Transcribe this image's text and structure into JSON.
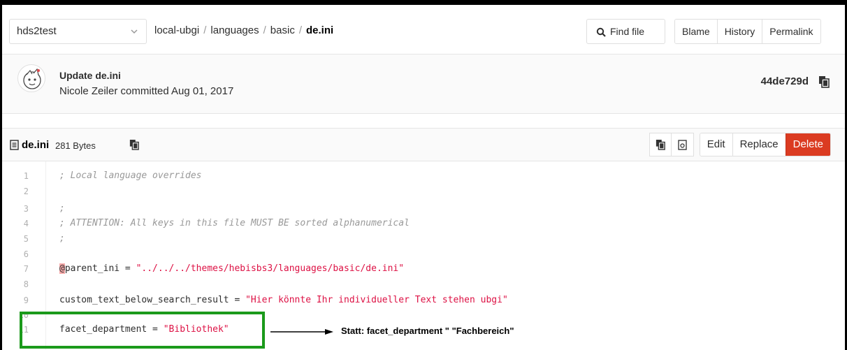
{
  "branch": {
    "name": "hds2test"
  },
  "breadcrumb": {
    "parts": [
      "local-ubgi",
      "languages",
      "basic"
    ],
    "file": "de.ini",
    "separator": "/"
  },
  "toolbar": {
    "find_file": "Find file",
    "blame": "Blame",
    "history": "History",
    "permalink": "Permalink"
  },
  "commit": {
    "title": "Update de.ini",
    "meta": "Nicole Zeiler committed Aug 01, 2017",
    "sha": "44de729d"
  },
  "file": {
    "name": "de.ini",
    "size": "281 Bytes",
    "edit": "Edit",
    "replace": "Replace",
    "delete": "Delete"
  },
  "code_lines": [
    {
      "n": "1",
      "text": "; Local language overrides"
    },
    {
      "n": "2",
      "text": ""
    },
    {
      "n": "3",
      "text": ";"
    },
    {
      "n": "4",
      "text": "; ATTENTION: All keys in this file MUST BE sorted alphanumerical"
    },
    {
      "n": "5",
      "text": ";"
    },
    {
      "n": "6",
      "text": ""
    },
    {
      "n": "7",
      "key": "parent_ini = ",
      "at": "@",
      "str": "\"../../../themes/hebisbs3/languages/basic/de.ini\""
    },
    {
      "n": "8",
      "text": ""
    },
    {
      "n": "9",
      "key": "custom_text_below_search_result = ",
      "str": "\"Hier könnte Ihr individueller Text stehen ubgi\""
    },
    {
      "n": "10",
      "text": ""
    },
    {
      "n": "11",
      "key": "facet_department = ",
      "str": "\"Bibliothek\""
    }
  ],
  "annotation": {
    "note": "Statt: facet_department \" \"Fachbereich\""
  },
  "colors": {
    "delete": "#db3b21",
    "highlight": "#1b9a1b",
    "string": "#d14"
  }
}
